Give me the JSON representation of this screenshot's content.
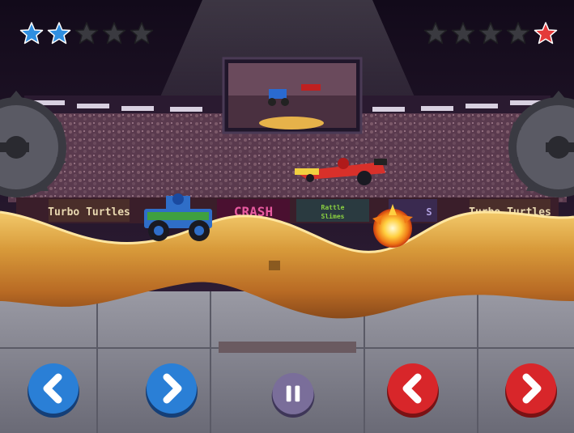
{
  "hud": {
    "player1": {
      "color": "#2f8fe0",
      "stars": [
        true,
        true,
        false,
        false,
        false
      ]
    },
    "player2": {
      "color": "#e43a3a",
      "stars": [
        false,
        false,
        false,
        false,
        true
      ]
    }
  },
  "banners": {
    "left": "Turbo Turtles",
    "crash": "CRASH",
    "slimes_line1": "Rattle",
    "slimes_line2": "Slimes",
    "partial": "S",
    "right": "Turbo Turtles"
  },
  "controls": {
    "p1_left_icon": "chevron-left-icon",
    "p1_right_icon": "chevron-right-icon",
    "pause_icon": "pause-icon",
    "p2_left_icon": "chevron-left-icon",
    "p2_right_icon": "chevron-right-icon",
    "blue": "#2a7fd6",
    "red": "#d8262a",
    "grey": "#7a6e9a"
  },
  "vehicles": {
    "player1": "blue-monster-truck",
    "player2": "red-dragster"
  }
}
